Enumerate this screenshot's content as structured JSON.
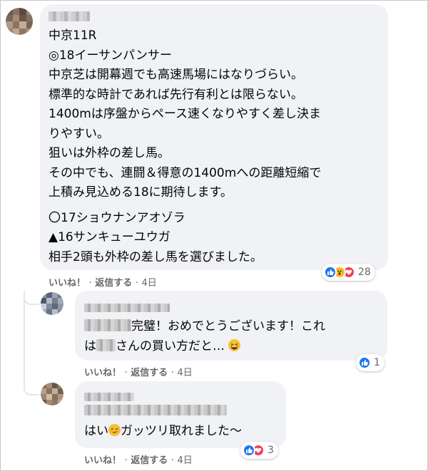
{
  "comments": [
    {
      "lines": [
        "中京11R",
        "◎18イーサンパンサー",
        "中京芝は開幕週でも高速馬場にはなりづらい。",
        "標準的な時計であれば先行有利とは限らない。",
        "1400mは序盤からペース速くなりやすく差し決ま",
        "りやすい。",
        "狙いは外枠の差し馬。",
        "その中でも、連闘＆得意の1400mへの距離短縮で",
        "上積み見込める18に期待します。"
      ],
      "lines2": [
        "〇17ショウナンアオゾラ",
        "▲16サンキューユウガ",
        "相手2頭も外枠の差し馬を選びました。"
      ],
      "like_label": "いいね！",
      "reply_label": "返信する",
      "time": "4日",
      "sep": "·",
      "reaction_count": "28",
      "reactions": [
        "like-icon",
        "wow-icon",
        "love-icon"
      ]
    },
    {
      "text_a": "完璧！おめでとうございます！これ",
      "text_b_1": "は",
      "text_b_2": "さんの買い方だと…",
      "emoji": "laughing-face-icon",
      "like_label": "いいね！",
      "reply_label": "返信する",
      "time": "4日",
      "sep": "·",
      "reaction_count": "1",
      "reactions": [
        "like-icon"
      ]
    },
    {
      "text_1": "はい",
      "text_2": "ガッツリ取れました〜",
      "emoji": "smirking-face-icon",
      "like_label": "いいね！",
      "reply_label": "返信する",
      "time": "4日",
      "sep": "·",
      "reaction_count": "3",
      "reactions": [
        "like-icon",
        "love-icon"
      ]
    }
  ],
  "colors": {
    "bubble": "#f0f2f5",
    "like": "#1877f2",
    "love": "#f33e58",
    "wow": "#f7b928",
    "meta": "#65676b"
  }
}
